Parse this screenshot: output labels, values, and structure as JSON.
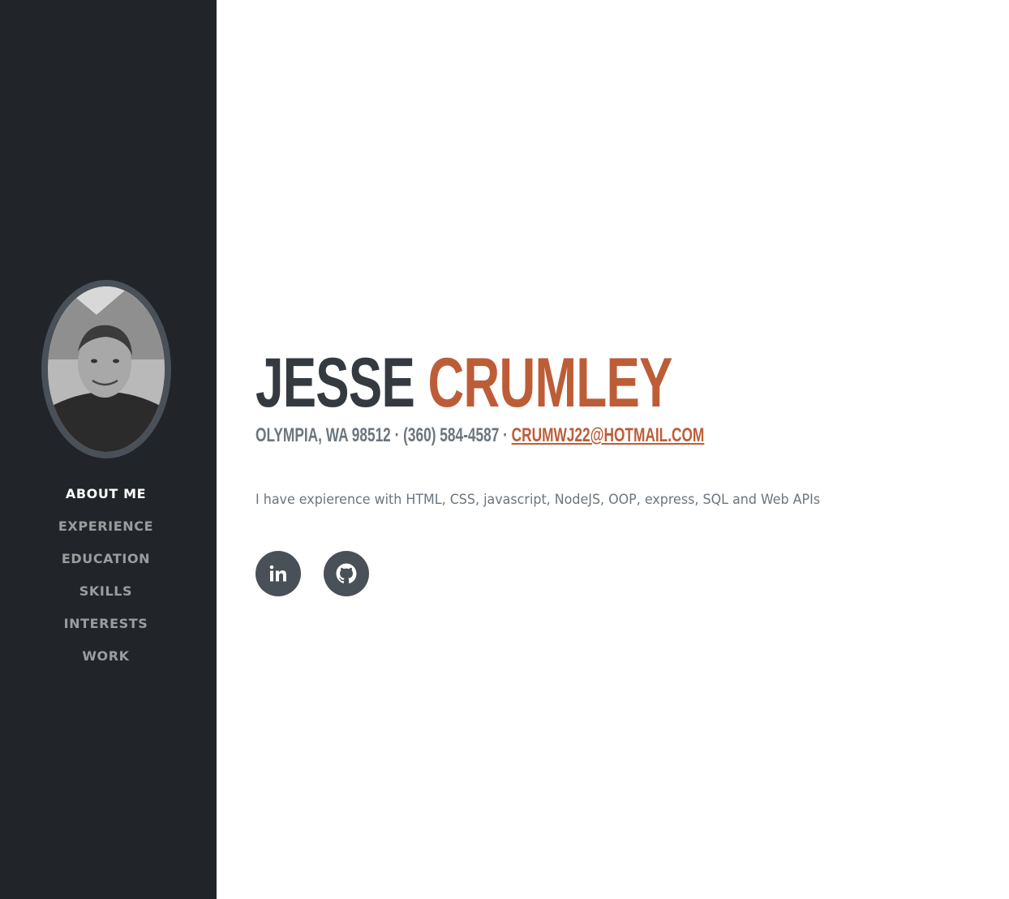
{
  "sidebar": {
    "avatar_alt": "profile photo",
    "nav": [
      {
        "label": "About Me",
        "active": true
      },
      {
        "label": "Experience",
        "active": false
      },
      {
        "label": "Education",
        "active": false
      },
      {
        "label": "Skills",
        "active": false
      },
      {
        "label": "Interests",
        "active": false
      },
      {
        "label": "Work",
        "active": false
      }
    ]
  },
  "main": {
    "first_name": "Jesse",
    "last_name": "Crumley",
    "contact": "Olympia, WA 98512 · (360) 584-4587 · ",
    "email": "crumwj22@hotmail.com",
    "bio": "I have expierence with HTML, CSS, javascript, NodeJS, OOP, express, SQL and Web APIs",
    "social": [
      {
        "icon": "linkedin-icon"
      },
      {
        "icon": "github-icon"
      }
    ]
  },
  "colors": {
    "sidebar_bg": "#212428",
    "accent": "#bd5d38",
    "heading": "#343a40",
    "muted": "#6c757d",
    "social_bg": "#495057"
  }
}
